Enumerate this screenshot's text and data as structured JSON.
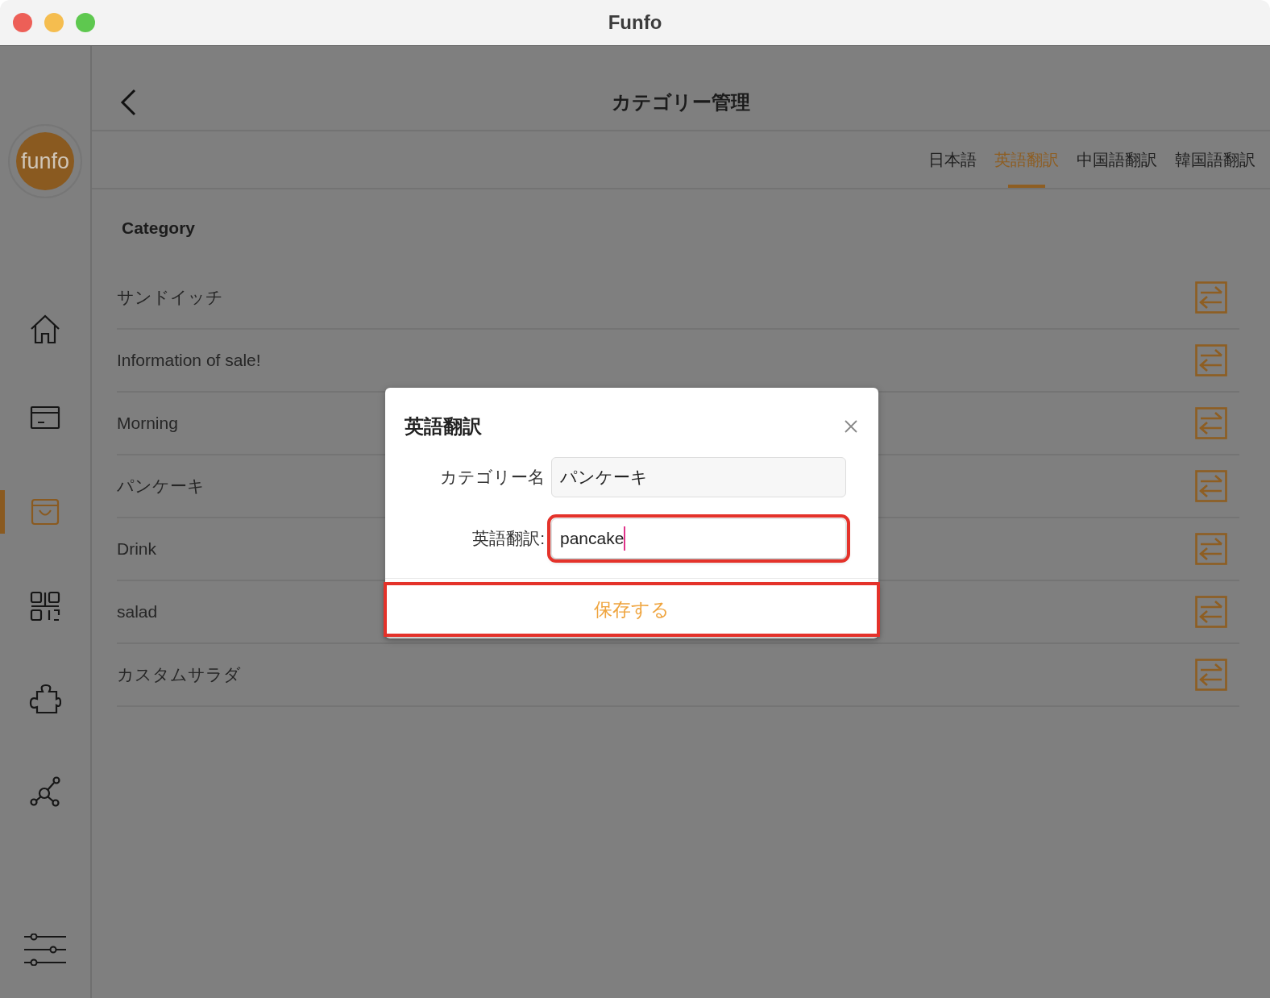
{
  "window": {
    "title": "Funfo"
  },
  "sidebar": {
    "logo": "funfo",
    "items": [
      {
        "kind": "home",
        "selected": false
      },
      {
        "kind": "card",
        "selected": false
      },
      {
        "kind": "bag",
        "selected": true
      },
      {
        "kind": "qr",
        "selected": false
      },
      {
        "kind": "puzzle",
        "selected": false
      },
      {
        "kind": "network",
        "selected": false
      },
      {
        "kind": "sliders",
        "selected": false
      }
    ]
  },
  "header": {
    "title": "カテゴリー管理"
  },
  "tabs": [
    {
      "label": "日本語",
      "selected": false
    },
    {
      "label": "英語翻訳",
      "selected": true
    },
    {
      "label": "中国語翻訳",
      "selected": false
    },
    {
      "label": "韓国語翻訳",
      "selected": false
    }
  ],
  "section_label": "Category",
  "categories": [
    {
      "name": "サンドイッチ"
    },
    {
      "name": "Information of sale!"
    },
    {
      "name": "Morning"
    },
    {
      "name": "パンケーキ"
    },
    {
      "name": "Drink"
    },
    {
      "name": "salad"
    },
    {
      "name": "カスタムサラダ"
    }
  ],
  "dialog": {
    "title": "英語翻訳",
    "fields": [
      {
        "label": "カテゴリー名",
        "value": "パンケーキ",
        "disabled": true,
        "highlighted": false
      },
      {
        "label": "英語翻訳:",
        "value": "pancake",
        "disabled": false,
        "highlighted": true
      }
    ],
    "save_button": {
      "label": "保存する",
      "highlighted": true
    }
  }
}
